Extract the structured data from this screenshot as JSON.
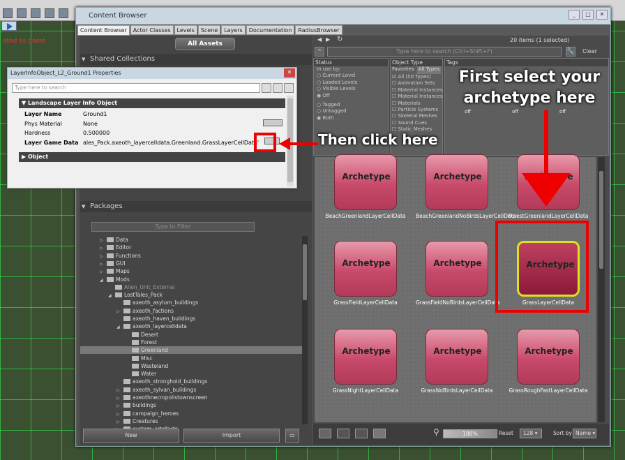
{
  "editor": {
    "status_text": "ated as game"
  },
  "window": {
    "title": "Content Browser",
    "tabs": [
      "Content Browser",
      "Actor Classes",
      "Levels",
      "Scene",
      "Layers",
      "Documentation",
      "RadiusBrowser"
    ]
  },
  "left": {
    "all_assets": "All Assets",
    "shared_collections": "Shared Collections",
    "packages": "Packages",
    "filter_placeholder": "Type to Filter",
    "tree": [
      {
        "label": "Data",
        "indent": 0,
        "arrow": "▷",
        "folder": true
      },
      {
        "label": "Editor",
        "indent": 0,
        "arrow": "▷",
        "folder": true
      },
      {
        "label": "Functions",
        "indent": 0,
        "arrow": "▷",
        "folder": true
      },
      {
        "label": "GUI",
        "indent": 0,
        "arrow": "▷",
        "folder": true
      },
      {
        "label": "Maps",
        "indent": 0,
        "arrow": "▷",
        "folder": true
      },
      {
        "label": "Mods",
        "indent": 0,
        "arrow": "◢",
        "folder": true
      },
      {
        "label": "Alien_Unit_External",
        "indent": 1,
        "arrow": "",
        "folder": true,
        "dim": true
      },
      {
        "label": "LostTales_Pack",
        "indent": 1,
        "arrow": "◢",
        "folder": true
      },
      {
        "label": "axeoth_asylum_buildings",
        "indent": 2,
        "arrow": "",
        "folder": true
      },
      {
        "label": "axeoth_factions",
        "indent": 2,
        "arrow": "▷",
        "folder": true
      },
      {
        "label": "axeoth_haven_buildings",
        "indent": 2,
        "arrow": "",
        "folder": true
      },
      {
        "label": "axeoth_layercelldata",
        "indent": 2,
        "arrow": "◢",
        "folder": true
      },
      {
        "label": "Desert",
        "indent": 3,
        "arrow": "",
        "folder": true
      },
      {
        "label": "Forest",
        "indent": 3,
        "arrow": "",
        "folder": true
      },
      {
        "label": "Greenland",
        "indent": 3,
        "arrow": "",
        "folder": true,
        "selected": true
      },
      {
        "label": "Misc",
        "indent": 3,
        "arrow": "",
        "folder": true
      },
      {
        "label": "Wasteland",
        "indent": 3,
        "arrow": "",
        "folder": true
      },
      {
        "label": "Water",
        "indent": 3,
        "arrow": "",
        "folder": true
      },
      {
        "label": "axeoth_stronghold_buildings",
        "indent": 2,
        "arrow": "",
        "folder": true
      },
      {
        "label": "axeoth_sylvan_buildings",
        "indent": 2,
        "arrow": "▷",
        "folder": true
      },
      {
        "label": "axeothnecropolistownscreen",
        "indent": 2,
        "arrow": "▷",
        "folder": true
      },
      {
        "label": "buildings",
        "indent": 2,
        "arrow": "▷",
        "folder": true
      },
      {
        "label": "campaign_heroes",
        "indent": 2,
        "arrow": "▷",
        "folder": true
      },
      {
        "label": "Creatures",
        "indent": 2,
        "arrow": "▷",
        "folder": true
      },
      {
        "label": "custom_artefacts",
        "indent": 2,
        "arrow": "▷",
        "folder": true
      }
    ],
    "new_label": "New",
    "import_label": "Import"
  },
  "right": {
    "count": "20 items (1 selected)",
    "search_placeholder": "Type here to search (Ctrl+Shift+F)",
    "clear": "Clear",
    "status_title": "Status",
    "in_use": "In use by:",
    "status_opts": [
      "Current Level",
      "Loaded Levels",
      "Visible Levels",
      "Off"
    ],
    "tag_opts": [
      "Tagged",
      "Untagged",
      "Both"
    ],
    "objtype_title": "Object Type",
    "favorites": "Favorites",
    "all_types": "All Types",
    "types": [
      "All (50 Types)",
      "Animation Sets",
      "Material Instances",
      "Material Instances",
      "Materials",
      "Particle Systems",
      "Skeletal Meshes",
      "Sound Cues",
      "Static Meshes"
    ],
    "tags_title": "Tags",
    "off": "off",
    "tiles": [
      {
        "label": "BeachGreenlandLayerCellData"
      },
      {
        "label": "BeachGreenlandNoBirdsLayerCellData"
      },
      {
        "label": "ForestGreenlandLayerCellData"
      },
      {
        "label": "GrassFieldLayerCellData"
      },
      {
        "label": "GrassFieldNoBirdsLayerCellData"
      },
      {
        "label": "GrassLayerCellData",
        "selected": true
      },
      {
        "label": "GrassNightLayerCellData"
      },
      {
        "label": "GrassNoBirdsLayerCellData"
      },
      {
        "label": "GrassRoughFastLayerCellData"
      }
    ],
    "archetype": "Archetype",
    "zoom": "100%",
    "reset": "Reset",
    "size": "128",
    "sort_by": "Sort by",
    "sort_value": "Name"
  },
  "props": {
    "title": "LayerInfoObject_L2_Ground1 Properties",
    "search_placeholder": "Type here to search",
    "group": "Landscape Layer Info Object",
    "rows": [
      {
        "k": "Layer Name",
        "v": "Ground1"
      },
      {
        "k": "Phys Material",
        "v": "None"
      },
      {
        "k": "Hardness",
        "v": "0.500000"
      },
      {
        "k": "Layer Game Data",
        "v": "ales_Pack.axeoth_layercelldata.Greenland.GrassLayerCellData'"
      }
    ],
    "object_group": "Object"
  },
  "annotations": {
    "first": "First select your archetype here",
    "then": "Then click here"
  },
  "colors": {
    "annotation_red": "#e00000",
    "selection_yellow": "#e0e020",
    "grid_green": "#28ff50"
  }
}
